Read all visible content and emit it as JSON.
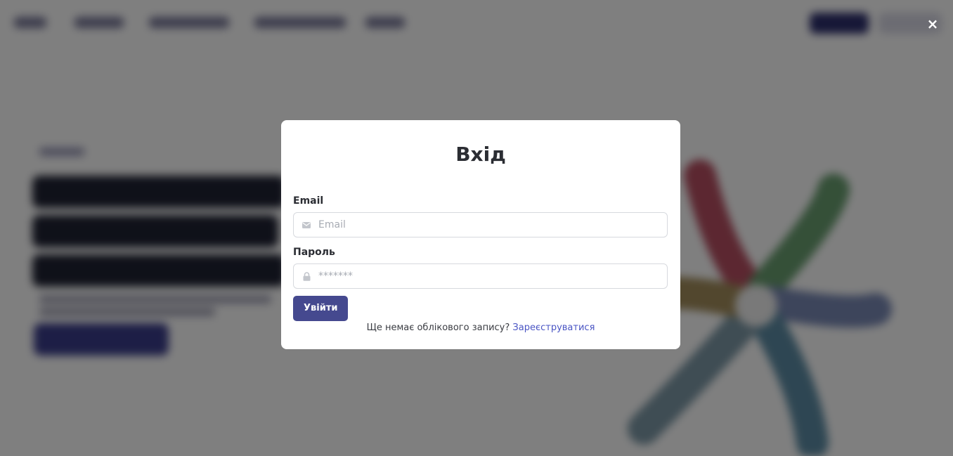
{
  "modal": {
    "title": "Вхід",
    "email_label": "Email",
    "email_placeholder": "Email",
    "email_value": "",
    "password_label": "Пароль",
    "password_placeholder": "*******",
    "password_value": "",
    "submit_label": "Увійти",
    "signup_prompt": "Ще немає облікового запису?",
    "signup_link": "Зареєструватися",
    "close_label": "×"
  },
  "icons": {
    "email": "mail-icon",
    "password": "lock-icon",
    "close": "close-icon"
  },
  "colors": {
    "primary_button": "#45498f",
    "link": "#4a55c4",
    "overlay": "rgba(0,0,0,0.5)"
  }
}
